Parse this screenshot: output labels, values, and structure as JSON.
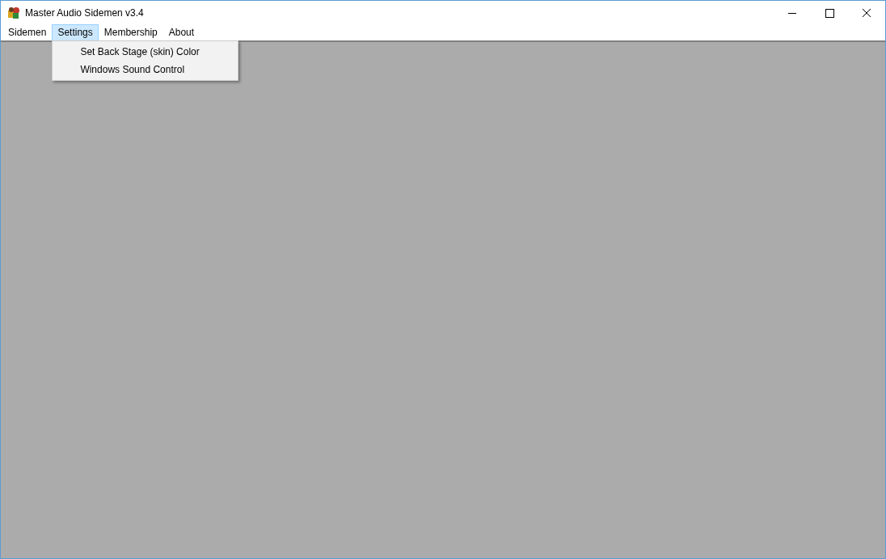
{
  "window": {
    "title": "Master Audio Sidemen v3.4"
  },
  "menu": [
    {
      "label": "Sidemen",
      "selected": false
    },
    {
      "label": "Settings",
      "selected": true
    },
    {
      "label": "Membership",
      "selected": false
    },
    {
      "label": "About",
      "selected": false
    }
  ],
  "dropdown": {
    "items": [
      "Set Back Stage (skin) Color",
      "Windows Sound Control"
    ]
  }
}
